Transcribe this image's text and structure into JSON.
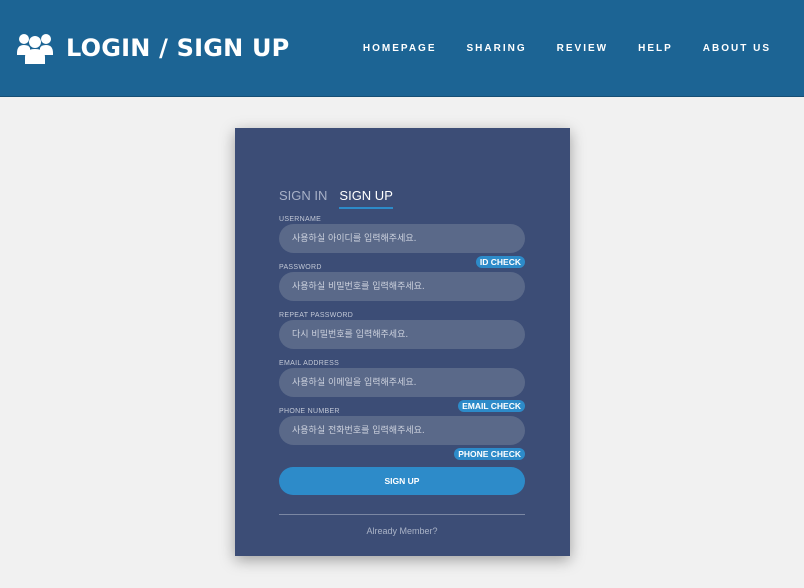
{
  "header": {
    "title": "LOGIN / SIGN UP",
    "logo_icon": "users-group-icon",
    "nav": [
      "HOMEPAGE",
      "SHARING",
      "REVIEW",
      "HELP",
      "ABOUT US"
    ]
  },
  "form": {
    "tabs": [
      "SIGN IN",
      "SIGN UP"
    ],
    "active_tab": "SIGN UP",
    "fields": [
      {
        "label": "USERNAME",
        "placeholder": "사용하실 아이디를 입력해주세요.",
        "value": ""
      },
      {
        "label": "PASSWORD",
        "placeholder": "사용하실 비밀번호를 입력해주세요.",
        "value": ""
      },
      {
        "label": "REPEAT PASSWORD",
        "placeholder": "다시 비밀번호를 입력해주세요.",
        "value": ""
      },
      {
        "label": "EMAIL ADDRESS",
        "placeholder": "사용하실 이메일을 입력해주세요.",
        "value": ""
      },
      {
        "label": "PHONE NUMBER",
        "placeholder": "사용하실 전화번호를 입력해주세요.",
        "value": ""
      }
    ],
    "id_check": "ID CHECK",
    "email_check": "EMAIL CHECK",
    "phone_check": "PHONE CHECK",
    "submit": "SIGN UP",
    "already_member": "Already Member?"
  },
  "colors": {
    "header_bg": "#1c6494",
    "card_bg": "#3c4d76",
    "accent": "#2d8bc9",
    "input_bg": "#5a6989"
  }
}
